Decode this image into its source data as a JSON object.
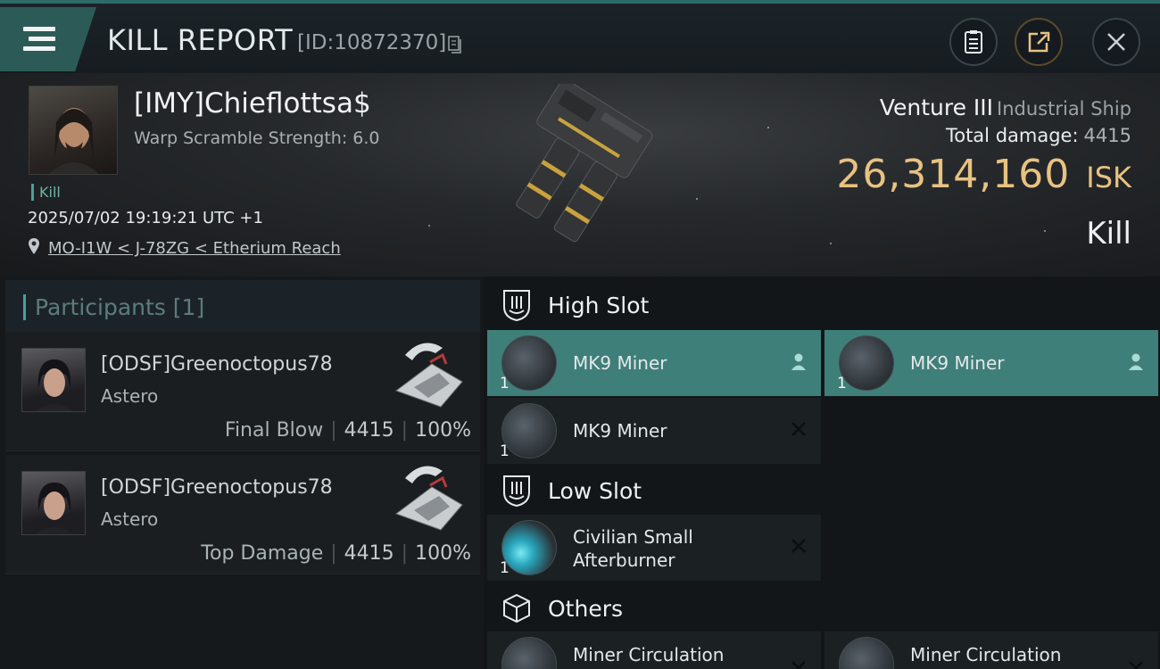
{
  "topbar": {
    "title": "KILL REPORT",
    "report_id": "[ID:10872370]",
    "icons": [
      "menu-icon",
      "copy-icon",
      "clipboard-icon",
      "share-icon",
      "close-icon"
    ]
  },
  "victim": {
    "name": "[IMY]Chieflottsa$",
    "warp_scramble": "Warp Scramble Strength: 6.0",
    "tag": "Kill",
    "datetime": "2025/07/02 19:19:21 UTC +1",
    "location": "MO-I1W < J-78ZG < Etherium Reach"
  },
  "ship": {
    "name": "Venture III",
    "class": "Industrial Ship",
    "damage_label": "Total damage:",
    "damage_value": "4415",
    "isk_value": "26,314,160",
    "isk_unit": "ISK",
    "result": "Kill"
  },
  "participants": {
    "header": "Participants [1]",
    "cards": [
      {
        "name": "[ODSF]Greenoctopus78",
        "ship": "Astero",
        "stat_label": "Final Blow",
        "damage": "4415",
        "percent": "100%"
      },
      {
        "name": "[ODSF]Greenoctopus78",
        "ship": "Astero",
        "stat_label": "Top Damage",
        "damage": "4415",
        "percent": "100%"
      }
    ]
  },
  "fittings": {
    "high_slot": {
      "label": "High Slot",
      "items": [
        {
          "name": "MK9 Miner",
          "qty": "1",
          "status": "dropped"
        },
        {
          "name": "MK9 Miner",
          "qty": "1",
          "status": "dropped"
        },
        {
          "name": "MK9 Miner",
          "qty": "1",
          "status": "destroyed"
        }
      ]
    },
    "low_slot": {
      "label": "Low Slot",
      "items": [
        {
          "name_line1": "Civilian Small",
          "name_line2": "Afterburner",
          "qty": "1",
          "status": "destroyed"
        }
      ]
    },
    "others": {
      "label": "Others",
      "items": [
        {
          "name": "Miner Circulation",
          "status": "destroyed"
        },
        {
          "name": "Miner Circulation",
          "status": "destroyed"
        }
      ]
    }
  },
  "colors": {
    "accent": "#47a29a",
    "isk": "#e8c282",
    "highlight": "#3f7f79"
  }
}
